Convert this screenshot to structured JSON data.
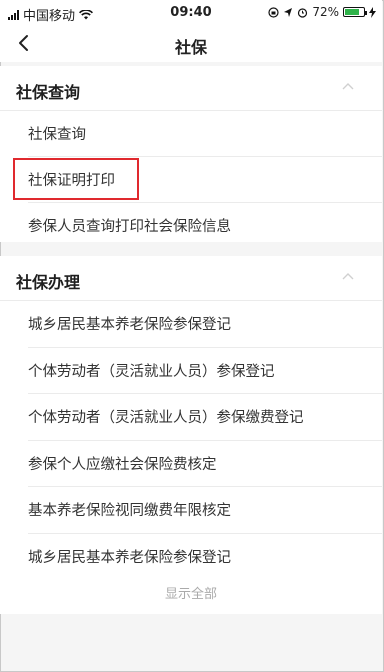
{
  "status_bar": {
    "carrier": "中国移动",
    "time": "09:40",
    "battery": "72%"
  },
  "nav": {
    "title": "社保",
    "back_icon": "chevron-left-icon"
  },
  "section1": {
    "title": "社保查询",
    "items": [
      {
        "label": "社保查询"
      },
      {
        "label": "社保证明打印"
      },
      {
        "label": "参保人员查询打印社会保险信息"
      }
    ]
  },
  "section2": {
    "title": "社保办理",
    "items": [
      {
        "label": "城乡居民基本养老保险参保登记"
      },
      {
        "label": "个体劳动者（灵活就业人员）参保登记"
      },
      {
        "label": "个体劳动者（灵活就业人员）参保缴费登记"
      },
      {
        "label": "参保个人应缴社会保险费核定"
      },
      {
        "label": "基本养老保险视同缴费年限核定"
      },
      {
        "label": "城乡居民基本养老保险参保登记"
      }
    ],
    "show_all": "显示全部"
  },
  "colors": {
    "highlight": "#e0292e",
    "battery": "#2fb34a"
  }
}
